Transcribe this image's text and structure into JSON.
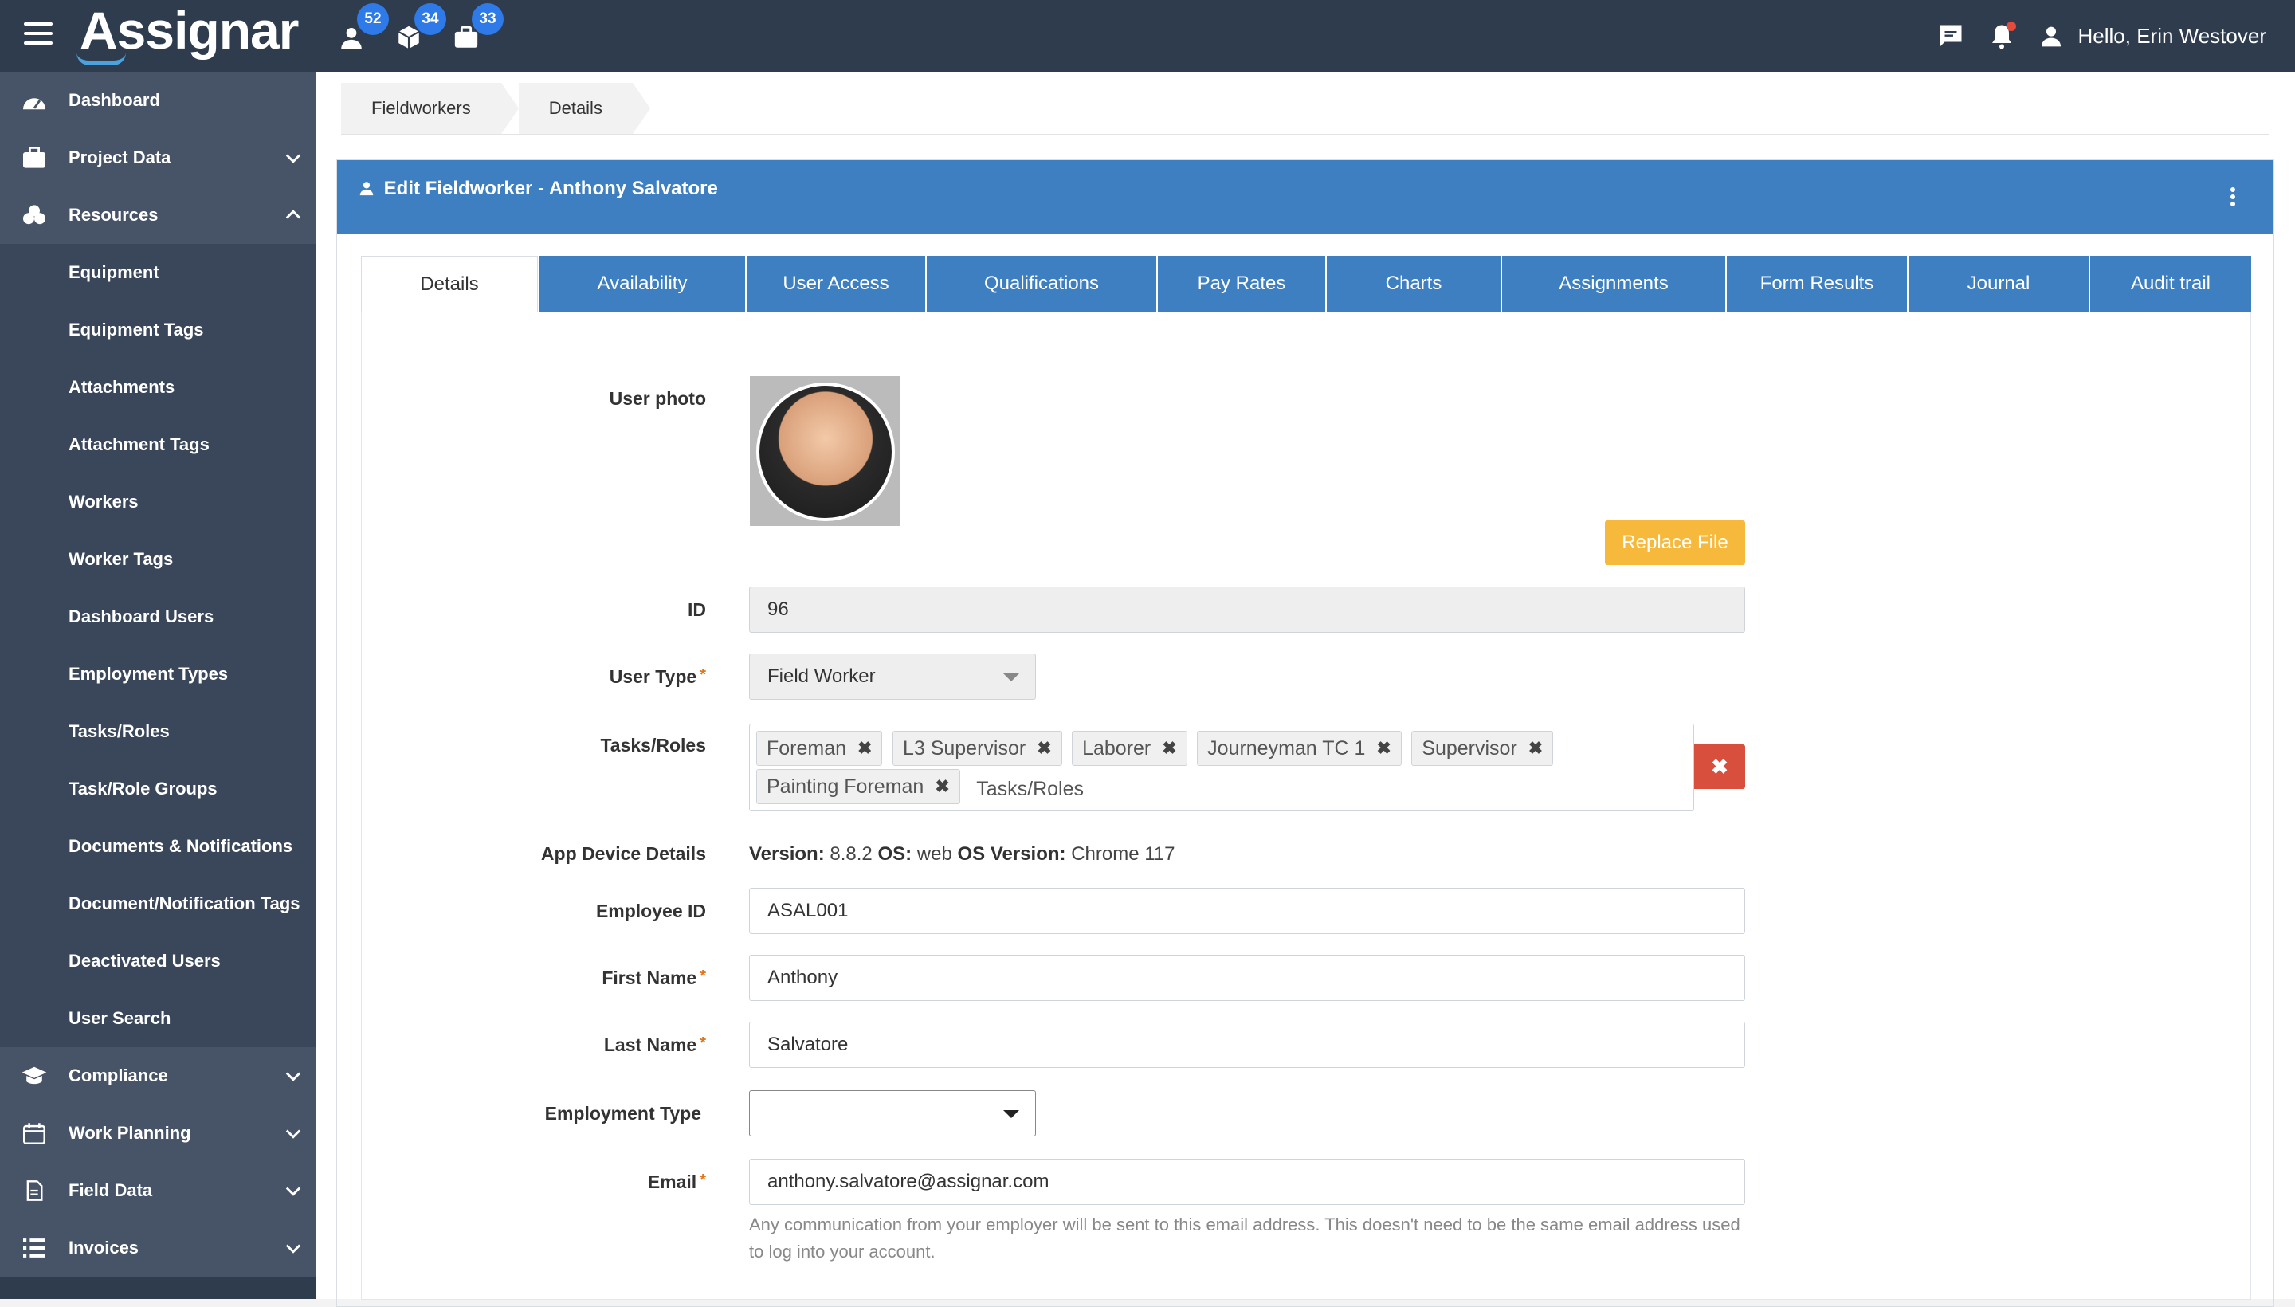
{
  "brand": {
    "name": "Assignar"
  },
  "header": {
    "badges": [
      {
        "icon": "user-icon",
        "count": "52"
      },
      {
        "icon": "cube-icon",
        "count": "34"
      },
      {
        "icon": "briefcase-icon",
        "count": "33"
      }
    ],
    "greeting": "Hello, Erin Westover"
  },
  "sidebar": {
    "items": [
      {
        "label": "Dashboard"
      },
      {
        "label": "Project Data"
      },
      {
        "label": "Resources"
      }
    ],
    "resources_sub": [
      "Equipment",
      "Equipment Tags",
      "Attachments",
      "Attachment Tags",
      "Workers",
      "Worker Tags",
      "Dashboard Users",
      "Employment Types",
      "Tasks/Roles",
      "Task/Role Groups",
      "Documents & Notifications",
      "Document/Notification Tags",
      "Deactivated Users",
      "User Search"
    ],
    "bottom": [
      {
        "label": "Compliance"
      },
      {
        "label": "Work Planning"
      },
      {
        "label": "Field Data"
      },
      {
        "label": "Invoices"
      }
    ]
  },
  "breadcrumb": [
    "Fieldworkers",
    "Details"
  ],
  "panel": {
    "title": "Edit Fieldworker - Anthony Salvatore"
  },
  "tabs": [
    "Details",
    "Availability",
    "User Access",
    "Qualifications",
    "Pay Rates",
    "Charts",
    "Assignments",
    "Form Results",
    "Journal",
    "Audit trail"
  ],
  "form": {
    "user_photo_label": "User photo",
    "replace_label": "Replace File",
    "id_label": "ID",
    "id_value": "96",
    "user_type_label": "User Type",
    "user_type_value": "Field Worker",
    "tasks_label": "Tasks/Roles",
    "tasks": [
      "Foreman",
      "L3 Supervisor",
      "Laborer",
      "Journeyman TC 1",
      "Supervisor",
      "Painting Foreman"
    ],
    "tasks_placeholder": "Tasks/Roles",
    "device_label": "App Device Details",
    "device": {
      "version_label": "Version:",
      "version": "8.8.2",
      "os_label": "OS:",
      "os": "web",
      "os_version_label": "OS Version:",
      "os_version": "Chrome 117"
    },
    "employee_id_label": "Employee ID",
    "employee_id_value": "ASAL001",
    "first_name_label": "First Name",
    "first_name_value": "Anthony",
    "last_name_label": "Last Name",
    "last_name_value": "Salvatore",
    "employment_type_label": "Employment Type",
    "employment_type_value": "",
    "email_label": "Email",
    "email_value": "anthony.salvatore@assignar.com",
    "email_help": "Any communication from your employer will be sent to this email address. This doesn't need to be the same email address used to log into your account."
  },
  "required_mark": "*"
}
